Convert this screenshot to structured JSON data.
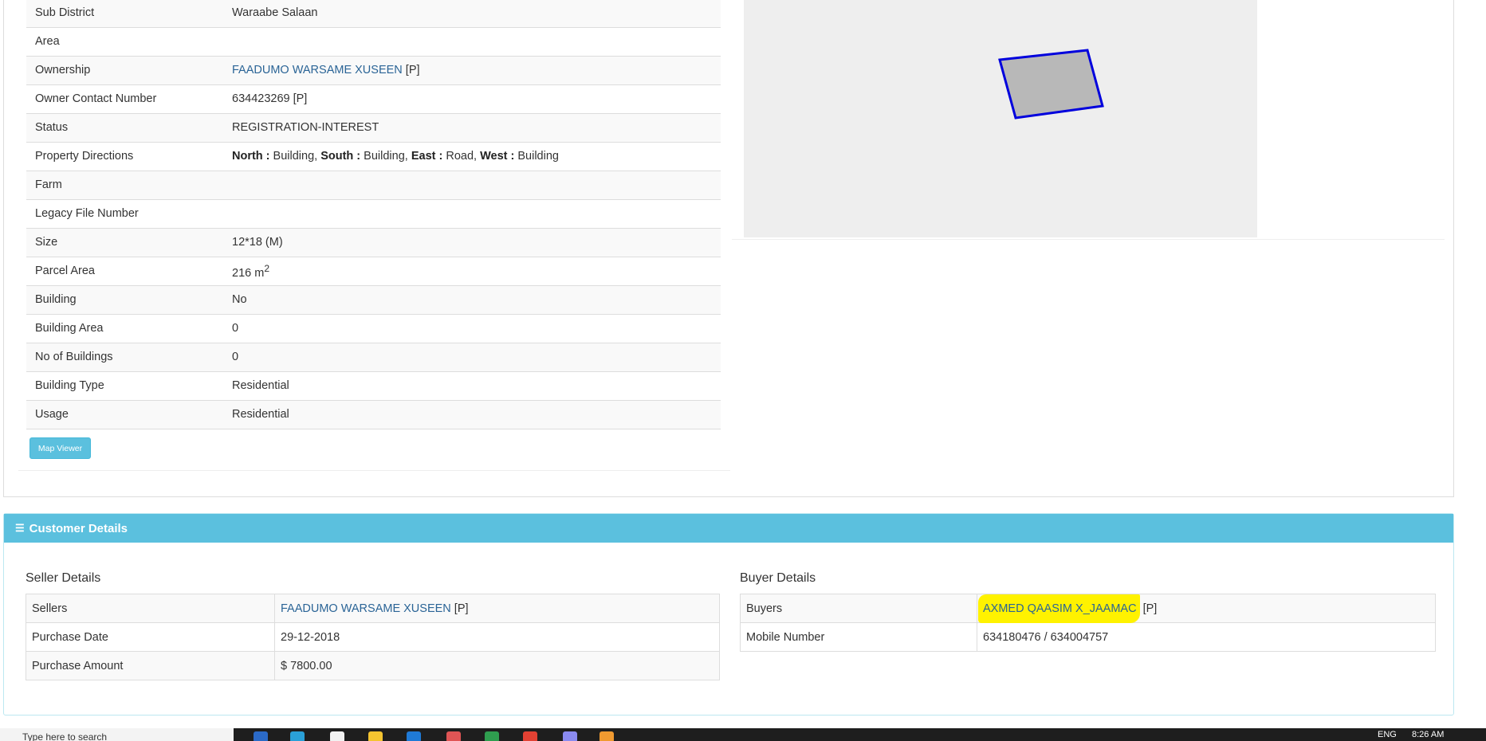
{
  "property": {
    "rows": [
      {
        "label": "Sub District",
        "value": "Waraabe Salaan"
      },
      {
        "label": "Area",
        "value": ""
      },
      {
        "label": "Ownership",
        "value": "FAADUMO WARSAME XUSEEN",
        "suffix": " [P]"
      },
      {
        "label": "Owner Contact Number",
        "value": "634423269 [P]"
      },
      {
        "label": "Status",
        "value": "REGISTRATION-INTEREST"
      },
      {
        "label": "Property Directions"
      },
      {
        "label": "Farm",
        "value": ""
      },
      {
        "label": "Legacy File Number",
        "value": ""
      },
      {
        "label": "Size",
        "value": "12*18 (M)"
      },
      {
        "label": "Parcel Area",
        "value": "216 m",
        "sup": "2"
      },
      {
        "label": "Building",
        "value": "No"
      },
      {
        "label": "Building Area",
        "value": "0"
      },
      {
        "label": "No of Buildings",
        "value": "0"
      },
      {
        "label": "Building Type",
        "value": "Residential"
      },
      {
        "label": "Usage",
        "value": "Residential"
      }
    ],
    "directions": {
      "north_label": "North :",
      "north_value": " Building, ",
      "south_label": "South :",
      "south_value": " Building, ",
      "east_label": "East :",
      "east_value": " Road, ",
      "west_label": "West :",
      "west_value": " Building"
    },
    "map_viewer_label": "Map Viewer"
  },
  "map": {
    "parcel_fill": "#b8b8b8",
    "parcel_stroke": "#0000dd",
    "background": "#eeeeee"
  },
  "customer": {
    "title": "Customer Details",
    "seller": {
      "title": "Seller Details",
      "sellers_label": "Sellers",
      "sellers_value": "FAADUMO WARSAME XUSEEN",
      "sellers_suffix": " [P]",
      "purchase_date_label": "Purchase Date",
      "purchase_date_value": "29-12-2018",
      "purchase_amount_label": "Purchase Amount",
      "purchase_amount_value": "$ 7800.00"
    },
    "buyer": {
      "title": "Buyer Details",
      "buyers_label": "Buyers",
      "buyers_value": "AXMED QAASIM X_JAAMAC",
      "buyers_suffix": " [P]",
      "mobile_label": "Mobile Number",
      "mobile_value": "634180476 / 634004757"
    }
  },
  "taskbar": {
    "search_placeholder": "Type here to search",
    "lang": "ENG",
    "time": "8:26 AM"
  },
  "colors": {
    "accent": "#5bc0de",
    "link": "#2a6496",
    "highlight": "#fff200"
  }
}
